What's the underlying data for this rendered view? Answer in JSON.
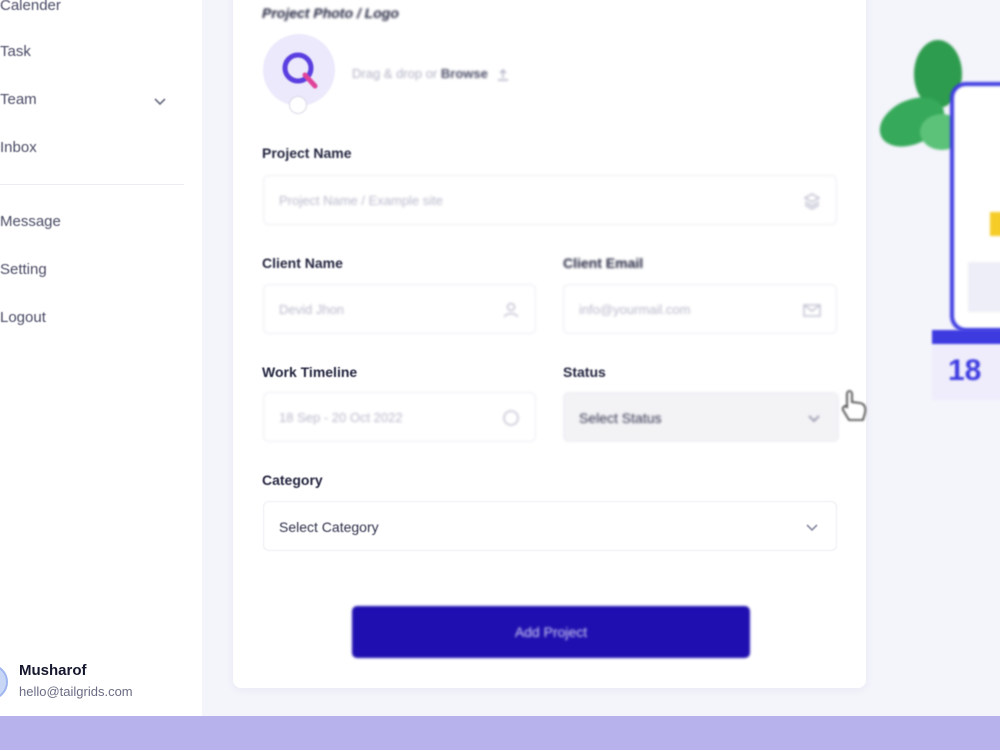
{
  "sidebar": {
    "items": [
      {
        "label": "Calender"
      },
      {
        "label": "Task"
      },
      {
        "label": "Team"
      },
      {
        "label": "Inbox"
      },
      {
        "label": "Message"
      },
      {
        "label": "Setting"
      },
      {
        "label": "Logout"
      }
    ],
    "user": {
      "name": "Musharof",
      "email": "hello@tailgrids.com"
    }
  },
  "form": {
    "logo_label": "Project Photo / Logo",
    "dropzone_text": "Drag & drop or",
    "dropzone_browse": "Browse",
    "project_name_label": "Project Name",
    "project_name_placeholder": "Project Name / Example site",
    "client_name_label": "Client Name",
    "client_name_placeholder": "Devid Jhon",
    "client_email_label": "Client Email",
    "client_email_placeholder": "info@yourmail.com",
    "timeline_label": "Work Timeline",
    "timeline_placeholder": "18 Sep - 20 Oct 2022",
    "status_label": "Status",
    "status_value": "Select Status",
    "category_label": "Category",
    "category_value": "Select Category",
    "submit_label": "Add Project"
  },
  "decoration": {
    "calendar_day": "18"
  },
  "colors": {
    "primary": "#1f0fb0",
    "accent": "#3d3be0",
    "band": "#b7b2eb"
  }
}
